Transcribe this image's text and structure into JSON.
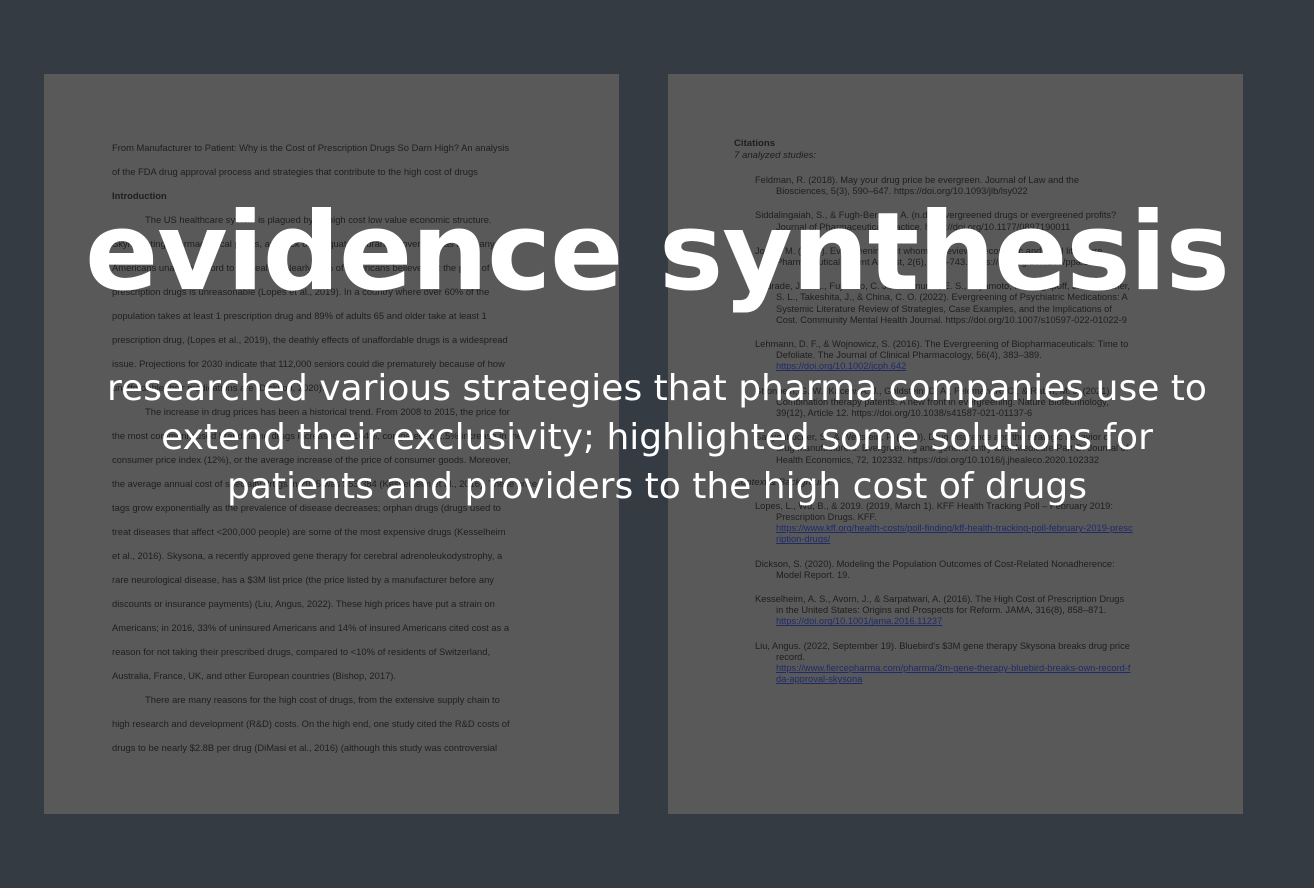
{
  "document_left": {
    "lines": [
      {
        "text": "From Manufacturer to Patient: Why is the Cost of Prescription Drugs So Darn High? An analysis",
        "style": ""
      },
      {
        "text": "of the FDA drug approval process and strategies that contribute to the high cost of drugs",
        "style": ""
      },
      {
        "text": "Introduction",
        "style": "bold"
      },
      {
        "text": "The US healthcare system is plagued by its high cost low value economic structure.",
        "style": "indent"
      },
      {
        "text": "Skyrocketing pharmaceutical prices, and lack of adequate insurance coverage has left many",
        "style": ""
      },
      {
        "text": "Americans unable to afford to be healthy. Nearly 60% of Americans believe that the price of",
        "style": ""
      },
      {
        "text": "prescription drugs is unreasonable (Lopes et al., 2019). In a country where over 60% of the",
        "style": ""
      },
      {
        "text": "population takes at least 1 prescription drug and 89% of adults 65 and older take at least 1",
        "style": ""
      },
      {
        "text": "prescription drug, (Lopes et al., 2019), the deathly effects of unaffordable drugs is a widespread",
        "style": ""
      },
      {
        "text": "issue. Projections for 2030 indicate that 112,000 seniors could die prematurely because of how",
        "style": ""
      },
      {
        "text": "unaffordable their medications are (Dickson, 2020).",
        "style": ""
      },
      {
        "text": "The increase in drug prices has been a historical trend. From 2008 to 2015, the price for",
        "style": "indent"
      },
      {
        "text": "the most commonly used brand name drugs increased by 164%, compared to 2.5% increase in the",
        "style": ""
      },
      {
        "text": "consumer price index (12%), or the average increase of the price of consumer goods. Moreover,",
        "style": ""
      },
      {
        "text": "the average annual cost of specialty drugs in 2015 was $53,384 (Kesselheim et al., 2016). These price",
        "style": ""
      },
      {
        "text": "tags grow exponentially as the prevalence of disease decreases; orphan drugs (drugs used to",
        "style": ""
      },
      {
        "text": "treat diseases that affect <200,000 people) are some of the most expensive drugs (Kesselheim",
        "style": ""
      },
      {
        "text": "et al., 2016). Skysona, a recently approved gene therapy for cerebral adrenoleukodystrophy, a",
        "style": ""
      },
      {
        "text": "rare neurological disease, has a $3M list price (the price listed by a manufacturer before any",
        "style": ""
      },
      {
        "text": "discounts or insurance payments) (Liu, Angus, 2022). These high prices have put a strain on",
        "style": ""
      },
      {
        "text": "Americans; in 2016, 33% of uninsured Americans and 14% of insured Americans cited cost as a",
        "style": ""
      },
      {
        "text": "reason for not taking their prescribed drugs, compared to <10% of residents of Switzerland,",
        "style": ""
      },
      {
        "text": "Australia, France, UK, and other European countries (Bishop, 2017).",
        "style": ""
      },
      {
        "text": "There are many reasons for the high cost of drugs, from the extensive supply chain to",
        "style": "indent"
      },
      {
        "text": "high research and development (R&D) costs. On the high end, one study cited the R&D costs of",
        "style": ""
      },
      {
        "text": "drugs to be nearly $2.8B per drug (DiMasi et al., 2016) (although this study was controversial",
        "style": ""
      }
    ]
  },
  "document_right": {
    "heading": "Citations",
    "subheading": "7 analyzed studies:",
    "entries": [
      {
        "lines": [
          "Feldman, R. (2018). May your drug price be evergreen. Journal of Law and the",
          "Biosciences, 5(3), 590–647. https://doi.org/10.1093/jlb/lsy022"
        ]
      },
      {
        "lines": [
          "Siddalingaiah, S., & Fugh-Berman, A. (n.d.). Evergreened drugs or evergreened profits?",
          "Journal of Pharmaceutical Practice. https://doi.org/10.1177/0897190011"
        ]
      },
      {
        "lines": [
          "Jones, M. (2018). Evergreening but whom? A review of economic and legal literature.",
          "Pharmaceutical Patent Analyst, 2(6), 731–743. https://doi.org/10.4155/ppa.13.57"
        ]
      },
      {
        "lines": [
          "Andrade, J. K. L., Fujimoto, C. J., Hishinuma, E. S., Miyamoto, I. A., Agapoff, J. A., Kracher,",
          "S. L., Takeshita, J., & China, C. O. (2022). Evergreening of Psychiatric Medications: A",
          "Systemic Literature Review of Strategies, Case Examples, and the Implications of",
          "Cost. Community Mental Health Journal. https://doi.org/10.1007/s10597-022-01022-9"
        ]
      },
      {
        "lines": [
          "Lehmann, D. F., & Wojnowicz, S. (2016). The Evergreening of Biopharmaceuticals: Time to",
          "Defoliate. The Journal of Clinical Pharmacology, 56(4), 383–389.",
          "https://doi.org/10.1002/jcph.642"
        ]
      },
      {
        "lines": [
          "Stronbein, G. W., Kacew, A. J., Goldstein, D. A., Feldman, R. C., & Rabin, M. J. (2021).",
          "Combination therapy patents: A new front in evergreening. Nature Biotechnology,",
          "39(12), Article 12. https://doi.org/10.1038/s41587-021-01137-6"
        ]
      },
      {
        "lines": [
          "Sanyenbucher, S., & Wettstein, P. (2020). Drug insurance and the strategic behavior of",
          "drug manufacturers: Evergreening and generic entry after Medicare Part D. Journal of",
          "Health Economics, 72, 102332. https://doi.org/10.1016/j.jhealeco.2020.102332"
        ]
      }
    ],
    "section_label": "Context & Background:",
    "background_entries": [
      {
        "lines": [
          "Lopes, L., Wu, B., & 2019. (2019, March 1). KFF Health Tracking Poll – February 2019:",
          "Prescription Drugs. KFF.",
          "https://www.kff.org/health-costs/poll-finding/kff-health-tracking-poll-february-2019-presc",
          "ription-drugs/"
        ]
      },
      {
        "lines": [
          "Dickson, S. (2020). Modeling the Population Outcomes of Cost-Related Nonadherence:",
          "Model Report. 19."
        ]
      },
      {
        "lines": [
          "Kesselheim, A. S., Avorn, J., & Sarpatwari, A. (2016). The High Cost of Prescription Drugs",
          "in the United States: Origins and Prospects for Reform. JAMA, 316(8), 858–871.",
          "https://doi.org/10.1001/jama.2016.11237"
        ]
      },
      {
        "lines": [
          "Liu, Angus. (2022, September 19). Bluebird's $3M gene therapy Skysona breaks drug price",
          "record.",
          "https://www.fiercepharma.com/pharma/3m-gene-therapy-bluebird-breaks-own-record-f",
          "da-approval-skysona"
        ]
      }
    ]
  },
  "overlay": {
    "headline": "evidence synthesis",
    "subtitle": "researched various strategies that pharma companies use to extend their exclusivity; highlighted some solutions for patients and providers to the high cost of drugs"
  },
  "colors": {
    "background": "#343b43",
    "page": "#59595a",
    "overlay_text": "#ffffff",
    "link": "#1f2a6b"
  }
}
